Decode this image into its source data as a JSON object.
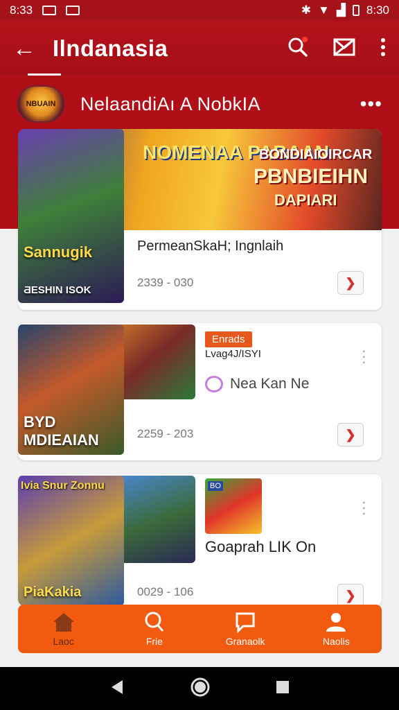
{
  "status_bar": {
    "time_left": "8:33",
    "time_right": "8:30"
  },
  "app_bar": {
    "title": "Ilndanasia"
  },
  "channel": {
    "name": "NelaandiAı A NobkIA",
    "logo_text": "NBUAIN"
  },
  "cards": [
    {
      "banner_title": "NOMENAA PABAAN",
      "banner_right_1": "BONDIAIOIRCAR",
      "banner_right_2": "PBNBIEIHN",
      "banner_right_3": "DAPIARI",
      "thumb_caption": "Sannugik",
      "thumb_caption_2": "ƋESHIN ISOK",
      "title": "PermeanSkaH; Ingnlaih",
      "meta": "2339 - 030"
    },
    {
      "thumb_caption": "BYD MDIEAIAN",
      "tag": "Enrads",
      "subtitle": "Lvag4J/ISYI",
      "chat_label": "Nea Kan Ne",
      "meta": "2259 - 203"
    },
    {
      "thumb_top_caption": "Ivia Snur Zonnu",
      "thumb_caption": "PiaKakia",
      "mini_label": "BO",
      "title": "Goaprah LIK On",
      "meta": "0029 - 106"
    }
  ],
  "bottom_nav": [
    {
      "label": "Laoc",
      "icon": "home-icon"
    },
    {
      "label": "Frie",
      "icon": "search-icon"
    },
    {
      "label": "Granaolk",
      "icon": "chat-icon"
    },
    {
      "label": "Naolis",
      "icon": "person-icon"
    }
  ],
  "colors": {
    "app_bar": "#b3121b",
    "accent": "#f25a10",
    "save": "#d32f2f"
  }
}
